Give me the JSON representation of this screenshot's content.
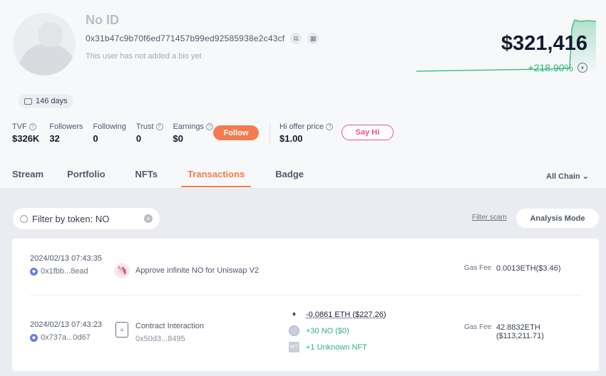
{
  "profile": {
    "name": "No ID",
    "address": "0x31b47c9b70f6ed771457b99ed92585938e2c43cf",
    "bio": "This user has not added a bio yet",
    "days": "146 days",
    "net_worth": "$321,416",
    "change": "+218.90%"
  },
  "stats": {
    "tvf_label": "TVF",
    "tvf": "$326K",
    "followers_label": "Followers",
    "followers": "32",
    "following_label": "Following",
    "following": "0",
    "trust_label": "Trust",
    "trust": "0",
    "earnings_label": "Earnings",
    "earnings": "$0",
    "follow_button": "Follow",
    "offer_label": "Hi offer price",
    "offer": "$1.00",
    "sayhi_button": "Say Hi"
  },
  "tabs": [
    "Stream",
    "Portfolio",
    "NFTs",
    "Transactions",
    "Badge"
  ],
  "active_tab": "Transactions",
  "chain_select": "All Chain",
  "filter": {
    "search_value": "Filter by token: NO",
    "filter_scam": "Filter scam",
    "analysis_mode": "Analysis Mode"
  },
  "transactions": [
    {
      "time": "2024/02/13 07:43:35",
      "hash": "0x1fbb...8ead",
      "description": "Approve infinite NO for Uniswap V2",
      "gas_label": "Gas Fee",
      "gas": "0.0013ETH($3.46)"
    },
    {
      "time": "2024/02/13 07:43:23",
      "hash": "0x737a...0d67",
      "description": "Contract Interaction",
      "contract": "0x50d3...8495",
      "token_out": "-0.0861 ETH ($227.26)",
      "token_in": "+30 NO ($0)",
      "nft_in": "+1 Unknown NFT",
      "gas_label": "Gas Fee",
      "gas": "42.8832ETH",
      "gas_usd": "($113,211.71)"
    }
  ],
  "colors": {
    "accent": "#f47b50",
    "positive": "#2fb57a",
    "pink": "#e0559a"
  }
}
